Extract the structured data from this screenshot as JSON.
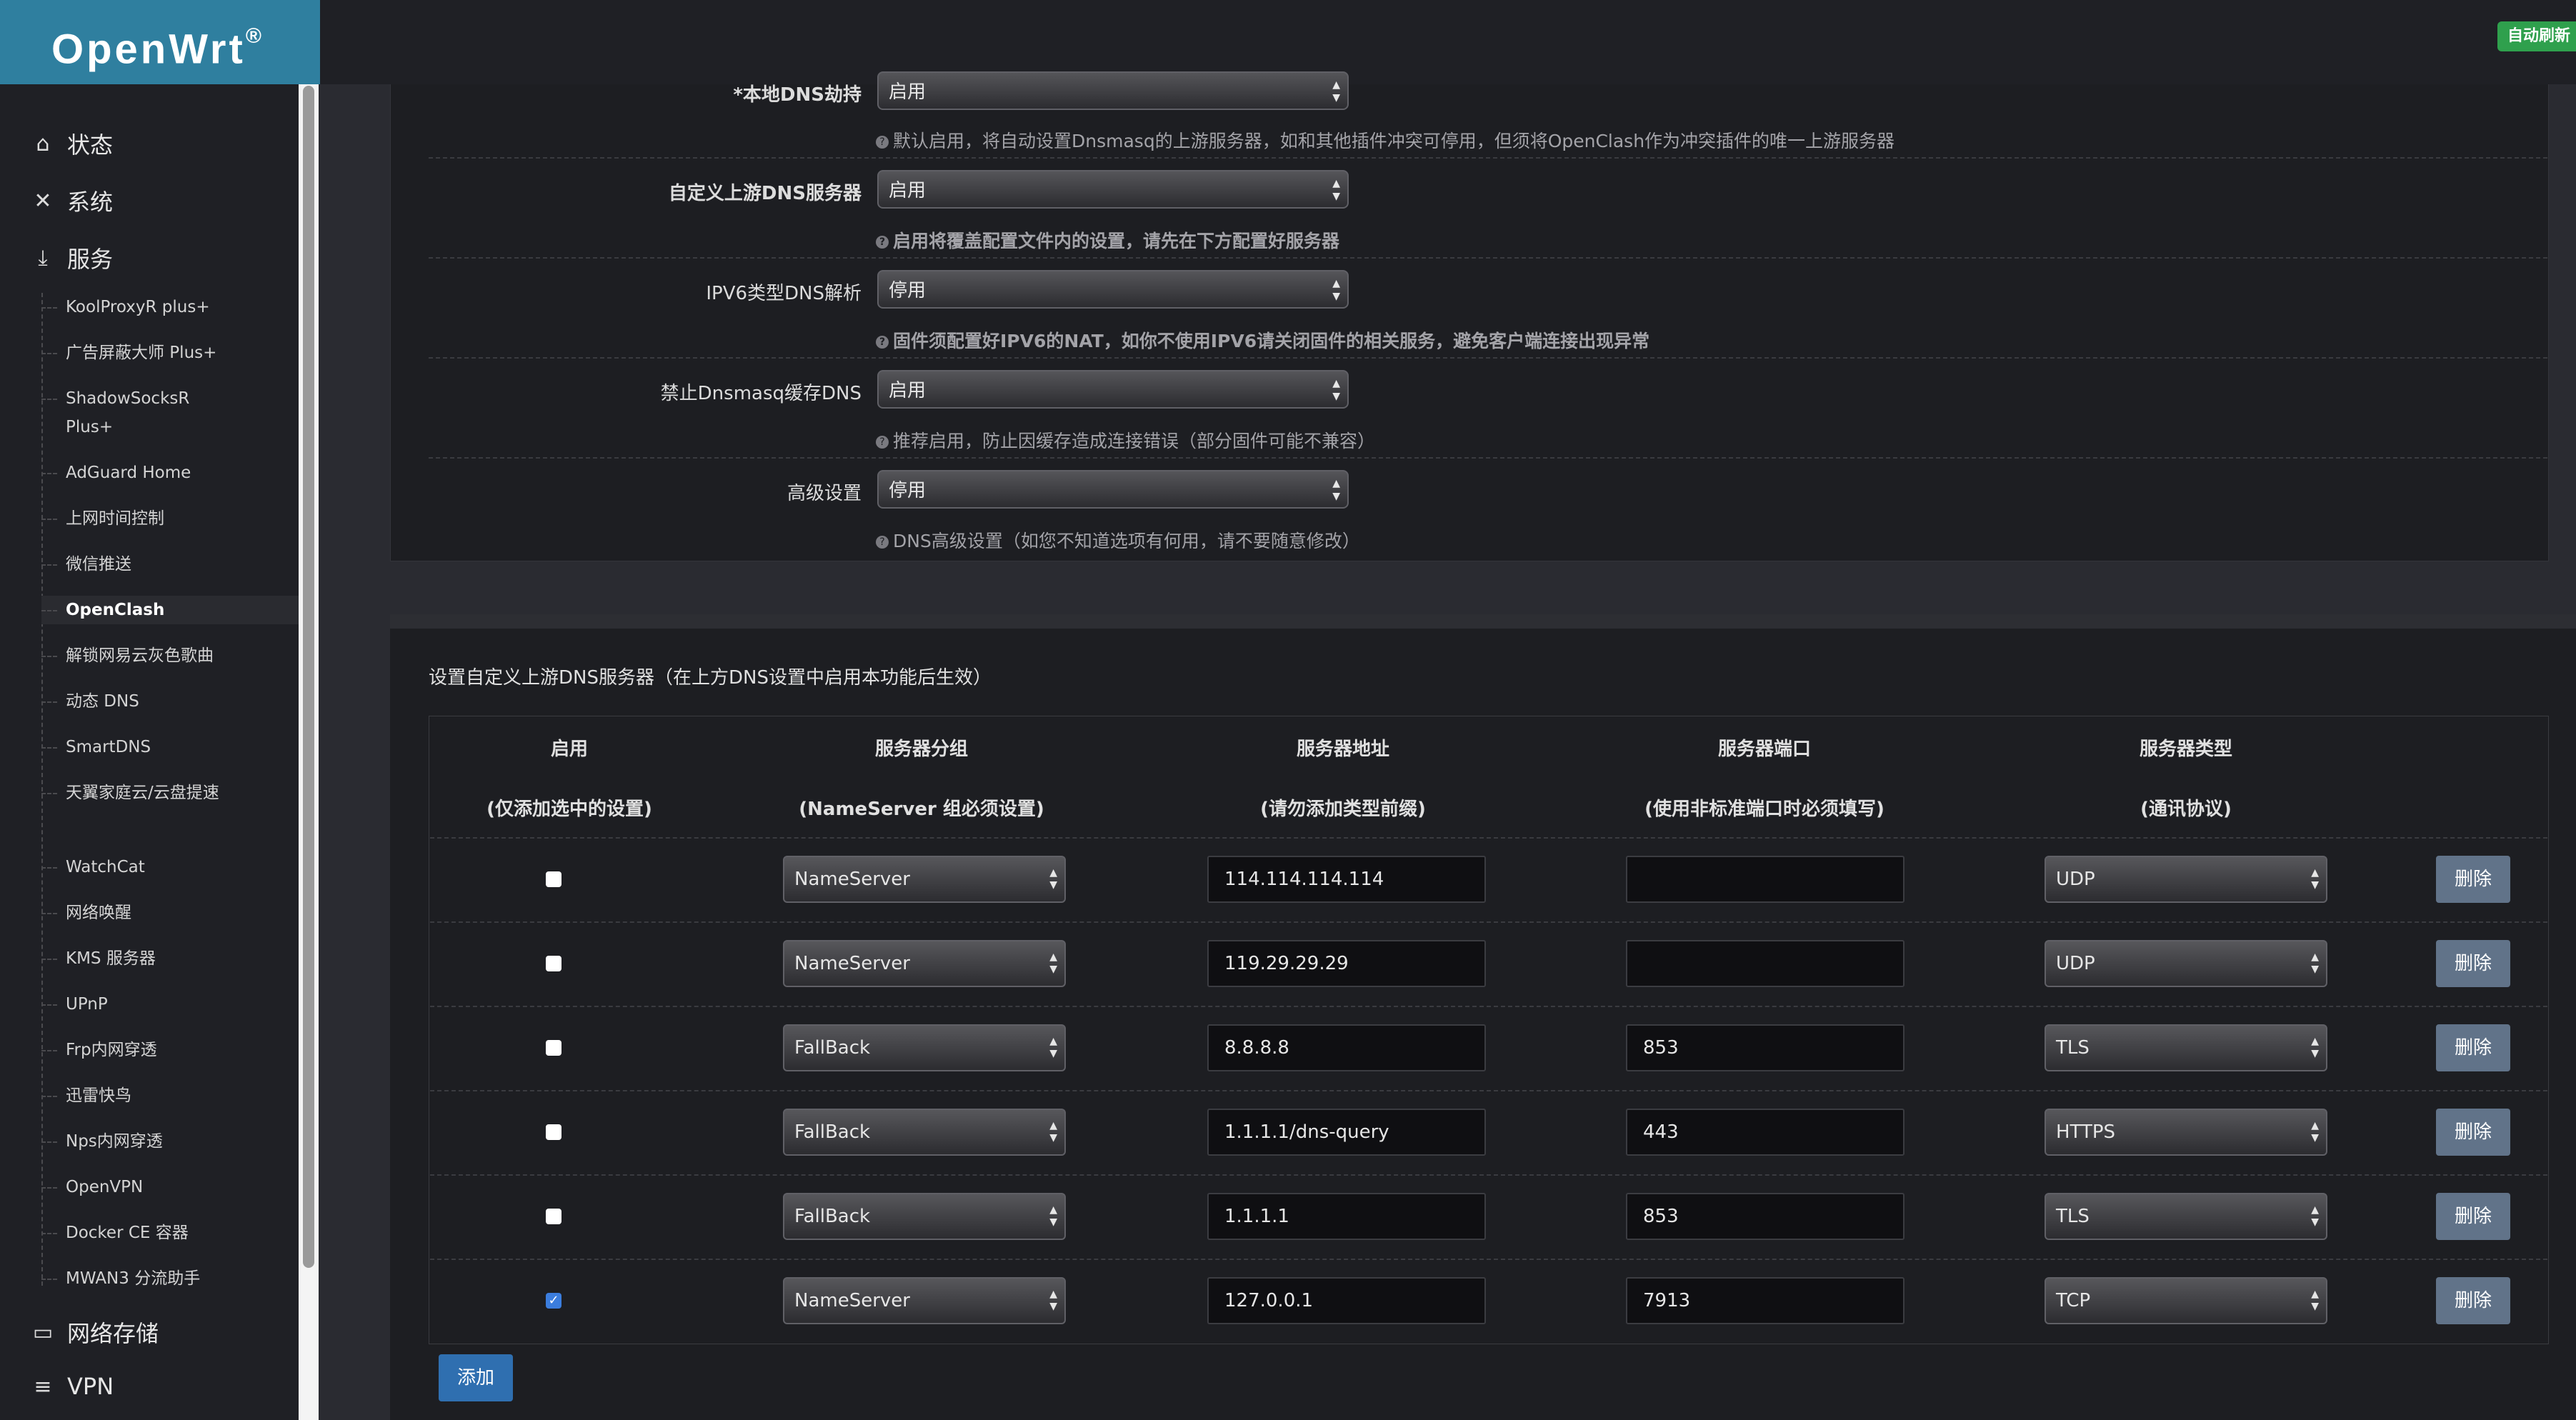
{
  "brand": {
    "name": "OpenWrt",
    "mark": "®"
  },
  "topbar": {
    "badge": "自动刷新"
  },
  "sidebar": {
    "top_items": [
      {
        "label": "状态",
        "icon": "home-icon"
      },
      {
        "label": "系统",
        "icon": "tools-icon"
      },
      {
        "label": "服务",
        "icon": "download-icon"
      }
    ],
    "services": [
      "KoolProxyR plus+",
      "广告屏蔽大师 Plus+",
      "ShadowSocksR Plus+",
      "AdGuard Home",
      "上网时间控制",
      "微信推送",
      "OpenClash",
      "解锁网易云灰色歌曲",
      "动态 DNS",
      "SmartDNS",
      "天翼家庭云/云盘提速",
      "WatchCat",
      "网络唤醒",
      "KMS 服务器",
      "UPnP",
      "Frp内网穿透",
      "迅雷快鸟",
      "Nps内网穿透",
      "OpenVPN",
      "Docker CE 容器",
      "MWAN3 分流助手"
    ],
    "bottom_items": [
      {
        "label": "网络存储",
        "icon": "storage-icon"
      },
      {
        "label": "VPN",
        "icon": "list-icon"
      }
    ]
  },
  "dns_settings": [
    {
      "label": "*本地DNS劫持",
      "value": "启用",
      "hint": "默认启用，将自动设置Dnsmasq的上游服务器，如和其他插件冲突可停用，但须将OpenClash作为冲突插件的唯一上游服务器",
      "bold": true,
      "hint_bold": false
    },
    {
      "label": "自定义上游DNS服务器",
      "value": "启用",
      "hint": "启用将覆盖配置文件内的设置，请先在下方配置好服务器",
      "bold": true,
      "hint_bold": true
    },
    {
      "label": "IPV6类型DNS解析",
      "value": "停用",
      "hint": "固件须配置好IPV6的NAT，如你不使用IPV6请关闭固件的相关服务，避免客户端连接出现异常",
      "bold": false,
      "hint_bold": true
    },
    {
      "label": "禁止Dnsmasq缓存DNS",
      "value": "启用",
      "hint": "推荐启用，防止因缓存造成连接错误（部分固件可能不兼容）",
      "bold": false,
      "hint_bold": false
    },
    {
      "label": "高级设置",
      "value": "停用",
      "hint": "DNS高级设置（如您不知道选项有何用，请不要随意修改）",
      "bold": false,
      "hint_bold": false
    }
  ],
  "servers_section": {
    "title": "设置自定义上游DNS服务器（在上方DNS设置中启用本功能后生效）",
    "headers": [
      {
        "title": "启用",
        "sub": "(仅添加选中的设置)"
      },
      {
        "title": "服务器分组",
        "sub": "(NameServer 组必须设置)"
      },
      {
        "title": "服务器地址",
        "sub": "(请勿添加类型前缀)"
      },
      {
        "title": "服务器端口",
        "sub": "(使用非标准端口时必须填写)"
      },
      {
        "title": "服务器类型",
        "sub": "(通讯协议)"
      }
    ],
    "rows": [
      {
        "enabled": false,
        "group": "NameServer",
        "address": "114.114.114.114",
        "port": "",
        "type": "UDP"
      },
      {
        "enabled": false,
        "group": "NameServer",
        "address": "119.29.29.29",
        "port": "",
        "type": "UDP"
      },
      {
        "enabled": false,
        "group": "FallBack",
        "address": "8.8.8.8",
        "port": "853",
        "type": "TLS"
      },
      {
        "enabled": false,
        "group": "FallBack",
        "address": "1.1.1.1/dns-query",
        "port": "443",
        "type": "HTTPS"
      },
      {
        "enabled": false,
        "group": "FallBack",
        "address": "1.1.1.1",
        "port": "853",
        "type": "TLS"
      },
      {
        "enabled": true,
        "group": "NameServer",
        "address": "127.0.0.1",
        "port": "7913",
        "type": "TCP"
      }
    ],
    "delete_label": "删除",
    "add_label": "添加"
  }
}
